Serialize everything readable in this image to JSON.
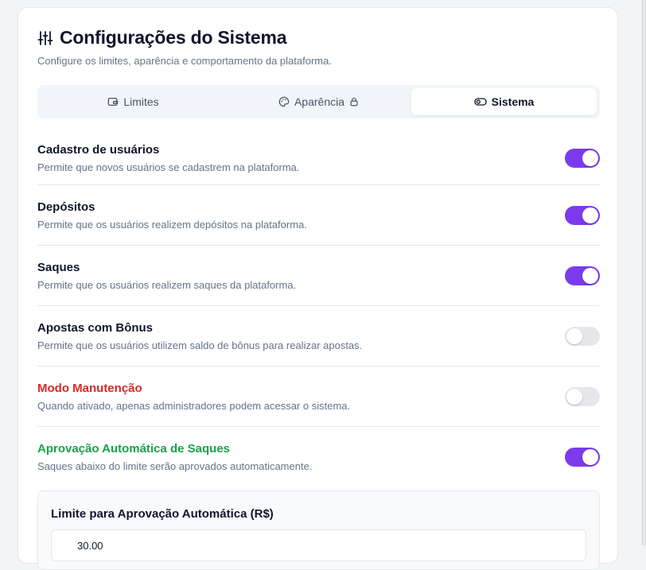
{
  "header": {
    "title": "Configurações do Sistema",
    "subtitle": "Configure os limites, aparência e comportamento da plataforma."
  },
  "tabs": [
    {
      "label": "Limites",
      "icon": "wallet-icon",
      "active": false
    },
    {
      "label": "Aparência",
      "icon": "palette-icon",
      "locked": true,
      "active": false
    },
    {
      "label": "Sistema",
      "icon": "toggle-icon",
      "active": true
    }
  ],
  "settings": [
    {
      "title": "Cadastro de usuários",
      "description": "Permite que novos usuários se cadastrem na plataforma.",
      "enabled": true
    },
    {
      "title": "Depósitos",
      "description": "Permite que os usuários realizem depósitos na plataforma.",
      "enabled": true
    },
    {
      "title": "Saques",
      "description": "Permite que os usuários realizem saques da plataforma.",
      "enabled": true
    },
    {
      "title": "Apostas com Bônus",
      "description": "Permite que os usuários utilizem saldo de bônus para realizar apostas.",
      "enabled": false
    },
    {
      "title": "Modo Manutenção",
      "description": "Quando ativado, apenas administradores podem acessar o sistema.",
      "enabled": false,
      "color": "#dc2626"
    },
    {
      "title": "Aprovação Automática de Saques",
      "description": "Saques abaixo do limite serão aprovados automaticamente.",
      "enabled": true,
      "color": "#16a34a"
    }
  ],
  "auto_approval": {
    "label": "Limite para Aprovação Automática (R$)",
    "value": "30.00"
  },
  "colors": {
    "accent": "#7c3aed",
    "danger": "#dc2626",
    "success": "#16a34a"
  }
}
